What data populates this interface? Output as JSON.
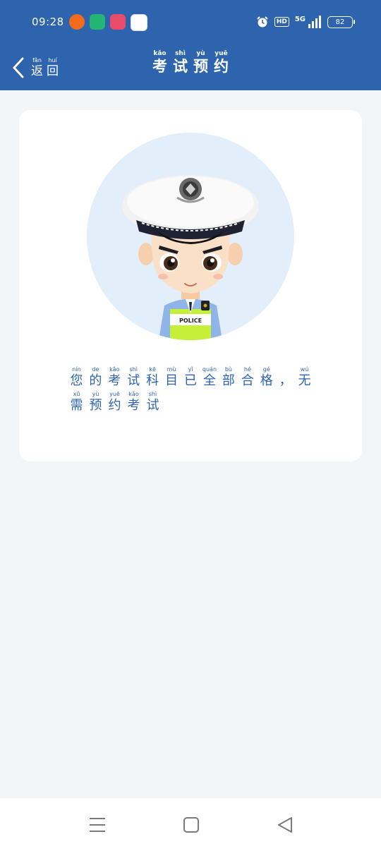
{
  "status_bar": {
    "time": "09:28",
    "hd_label": "HD",
    "network_label": "5G",
    "battery_level": "82"
  },
  "header": {
    "back": {
      "chars": [
        {
          "pinyin": "fǎn",
          "hanzi": "返"
        },
        {
          "pinyin": "huí",
          "hanzi": "回"
        }
      ]
    },
    "title": [
      {
        "pinyin": "kǎo",
        "hanzi": "考"
      },
      {
        "pinyin": "shì",
        "hanzi": "试"
      },
      {
        "pinyin": "yù",
        "hanzi": "预"
      },
      {
        "pinyin": "yuē",
        "hanzi": "约"
      }
    ]
  },
  "card": {
    "badge_text": "POLICE",
    "message_lines": [
      [
        {
          "pinyin": "nín",
          "hanzi": "您"
        },
        {
          "pinyin": "de",
          "hanzi": "的"
        },
        {
          "pinyin": "kǎo",
          "hanzi": "考"
        },
        {
          "pinyin": "shì",
          "hanzi": "试"
        },
        {
          "pinyin": "kē",
          "hanzi": "科"
        },
        {
          "pinyin": "mù",
          "hanzi": "目"
        },
        {
          "pinyin": "yǐ",
          "hanzi": "已"
        },
        {
          "pinyin": "quán",
          "hanzi": "全"
        },
        {
          "pinyin": "bù",
          "hanzi": "部"
        },
        {
          "pinyin": "hé",
          "hanzi": "合"
        },
        {
          "pinyin": "gé",
          "hanzi": "格"
        },
        {
          "pinyin": "",
          "hanzi": "，"
        },
        {
          "pinyin": "wú",
          "hanzi": "无"
        }
      ],
      [
        {
          "pinyin": "xū",
          "hanzi": "需"
        },
        {
          "pinyin": "yù",
          "hanzi": "预"
        },
        {
          "pinyin": "yuē",
          "hanzi": "约"
        },
        {
          "pinyin": "kǎo",
          "hanzi": "考"
        },
        {
          "pinyin": "shì",
          "hanzi": "试"
        }
      ]
    ]
  },
  "colors": {
    "brand_blue": "#2d64ad",
    "page_bg": "#f3f6f9",
    "avatar_bg": "#e3eefb"
  },
  "icons": {
    "back": "chevron-left-icon",
    "menu": "menu-icon",
    "home": "home-icon",
    "nav_back": "triangle-back-icon"
  }
}
